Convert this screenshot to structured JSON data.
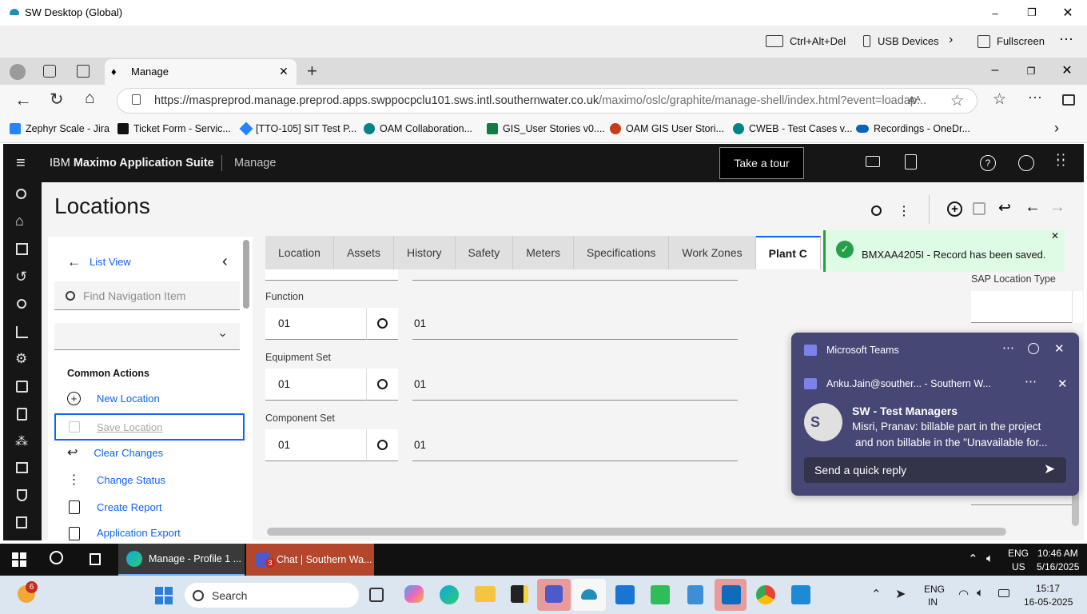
{
  "window": {
    "title": "SW Desktop (Global)"
  },
  "sw_toolbar": {
    "ctrl_alt_del": "Ctrl+Alt+Del",
    "usb": "USB Devices",
    "fullscreen": "Fullscreen"
  },
  "edge": {
    "tab_title": "Manage",
    "url_host": "https://maspreprod.manage.preprod.apps.swppocpclu101.sws.intl.southernwater.co.uk",
    "url_path": "/maximo/oslc/graphite/manage-shell/index.html?event=loadap...",
    "bookmarks": [
      "Zephyr Scale - Jira",
      "Ticket Form - Servic...",
      "[TTO-105] SIT Test P...",
      "OAM Collaboration...",
      "GIS_User Stories v0....",
      "OAM GIS User Stori...",
      "CWEB - Test Cases v...",
      "Recordings - OneDr..."
    ]
  },
  "maximo": {
    "brand_light": "IBM ",
    "brand_bold": "Maximo Application Suite",
    "app": "Manage",
    "tour": "Take a tour",
    "page_title": "Locations",
    "nav": {
      "list_view": "List View",
      "find_placeholder": "Find Navigation Item",
      "common_actions": "Common Actions",
      "actions": [
        "New Location",
        "Save Location",
        "Clear Changes",
        "Change Status",
        "Create Report",
        "Application Export"
      ]
    },
    "tabs": [
      "Location",
      "Assets",
      "History",
      "Safety",
      "Meters",
      "Specifications",
      "Work Zones",
      "Plant C"
    ],
    "fields": [
      {
        "label": "Function",
        "value": "01",
        "desc": "01"
      },
      {
        "label": "Equipment Set",
        "value": "01",
        "desc": "01"
      },
      {
        "label": "Component Set",
        "value": "01",
        "desc": "01"
      }
    ],
    "sap_location_type": "SAP Location Type",
    "toast": "BMXAA4205I - Record has been saved."
  },
  "teams": {
    "app": "Microsoft Teams",
    "account": "Anku.Jain@souther... - Southern W...",
    "chat_title": "SW - Test Managers",
    "message_line1": "Misri, Pranav: billable part in the project",
    "message_line2": "and non billable in the \"Unavailable for...",
    "avatar_initial": "S",
    "reply_placeholder": "Send a quick reply"
  },
  "remote_taskbar": {
    "apps": [
      "Manage - Profile 1 ...",
      "Chat | Southern Wa..."
    ],
    "lang1": "ENG",
    "lang2": "US",
    "time": "10:46 AM",
    "date": "5/16/2025",
    "teams_badge": "3"
  },
  "host_taskbar": {
    "search": "Search",
    "lang1": "ENG",
    "lang2": "IN",
    "time": "15:17",
    "date": "16-05-2025",
    "weather_badge": "6"
  }
}
